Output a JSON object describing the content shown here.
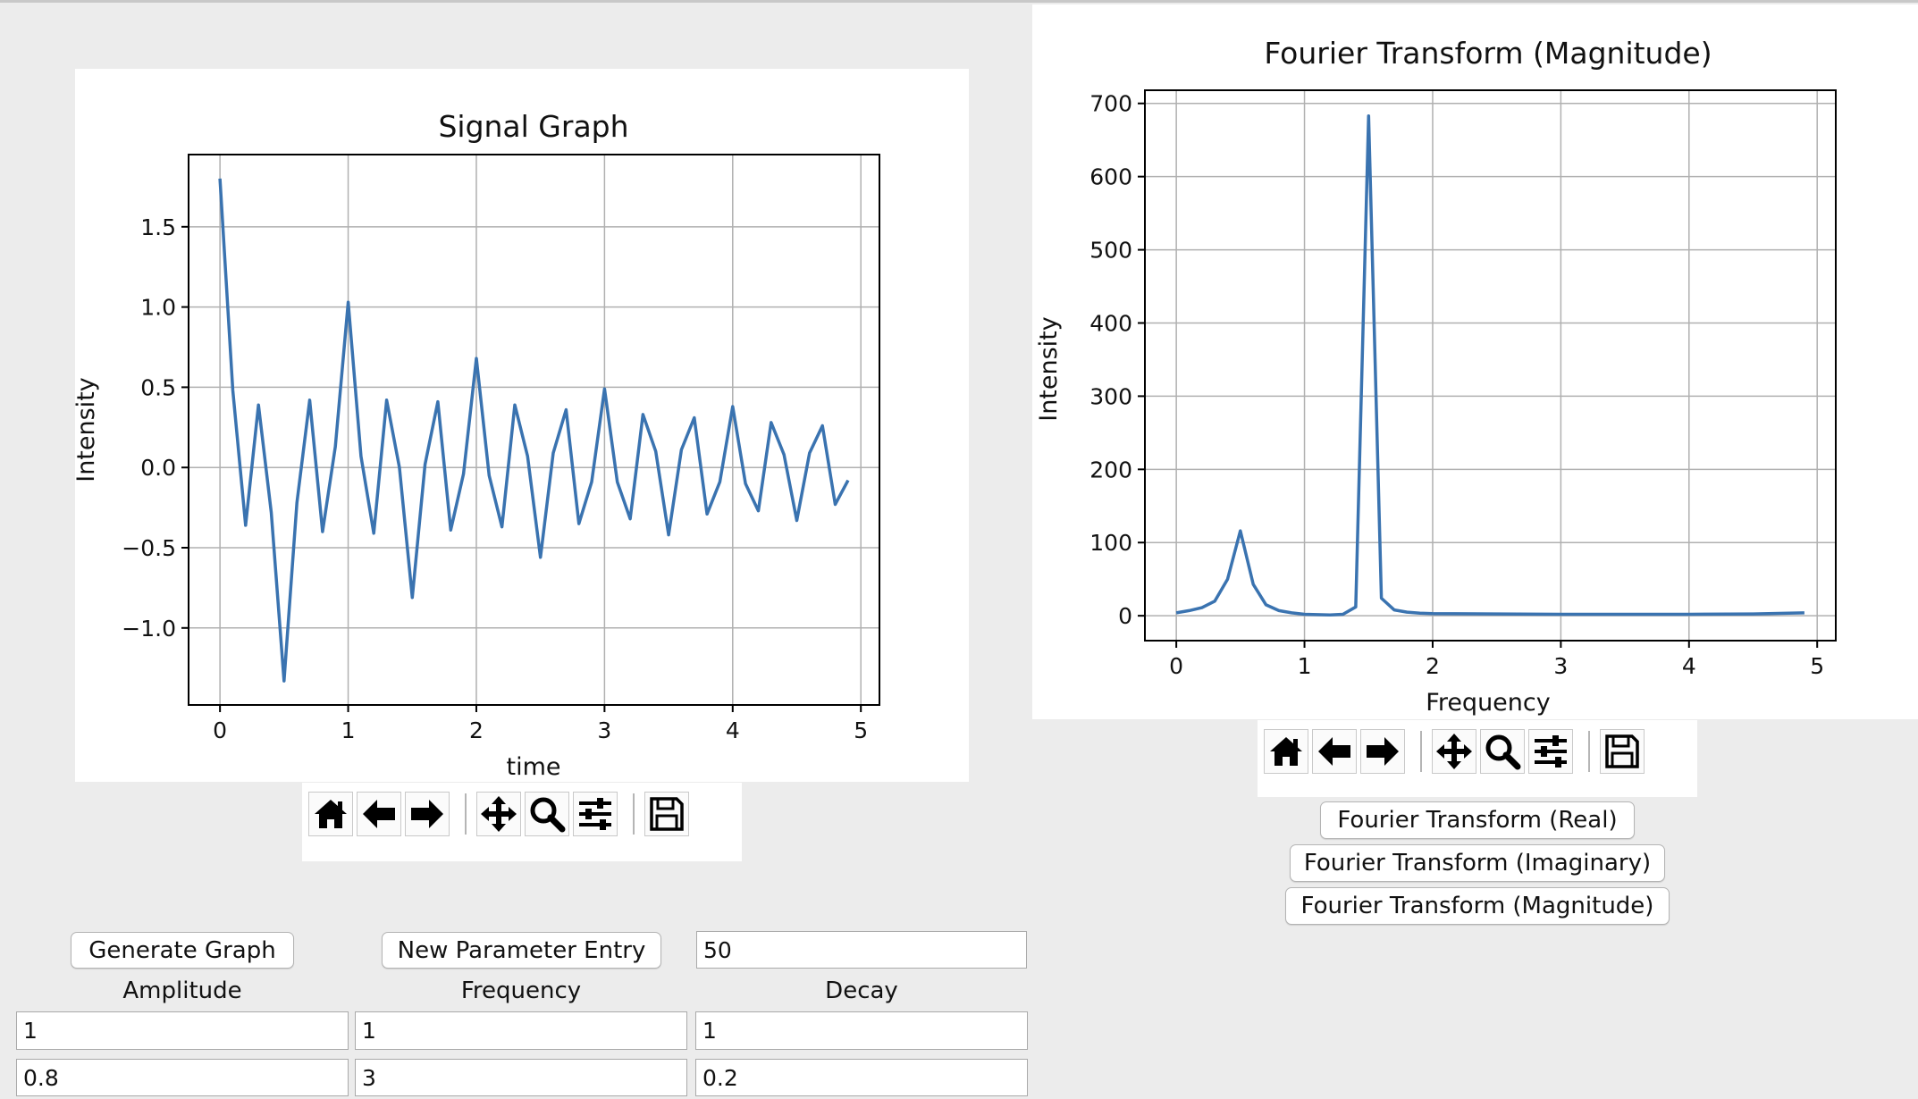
{
  "signal_plot": {
    "chart_data": {
      "type": "line",
      "title": "Signal Graph",
      "xlabel": "time",
      "ylabel": "Intensity",
      "xlim": [
        -0.245,
        5.145
      ],
      "ylim": [
        -1.48,
        1.95
      ],
      "xticks": [
        0,
        1,
        2,
        3,
        4,
        5
      ],
      "yticks": [
        -1.0,
        -0.5,
        0.0,
        0.5,
        1.0,
        1.5
      ],
      "ytick_labels": [
        "−1.0",
        "−0.5",
        "0.0",
        "0.5",
        "1.0",
        "1.5"
      ],
      "grid": true,
      "series": [
        {
          "color": "#3a73b0",
          "x": [
            0,
            0.1,
            0.2,
            0.3,
            0.4,
            0.5,
            0.6,
            0.7,
            0.8,
            0.9,
            1.0,
            1.1,
            1.2,
            1.3,
            1.4,
            1.5,
            1.6,
            1.7,
            1.8,
            1.9,
            2.0,
            2.1,
            2.2,
            2.3,
            2.4,
            2.5,
            2.6,
            2.7,
            2.8,
            2.9,
            3.0,
            3.1,
            3.2,
            3.3,
            3.4,
            3.5,
            3.6,
            3.7,
            3.8,
            3.9,
            4.0,
            4.1,
            4.2,
            4.3,
            4.4,
            4.5,
            4.6,
            4.7,
            4.8,
            4.9
          ],
          "y": [
            1.8,
            0.48,
            -0.36,
            0.39,
            -0.28,
            -1.33,
            -0.22,
            0.42,
            -0.4,
            0.13,
            1.03,
            0.07,
            -0.41,
            0.42,
            0.0,
            -0.81,
            0.02,
            0.41,
            -0.39,
            -0.04,
            0.68,
            -0.05,
            -0.37,
            0.39,
            0.07,
            -0.56,
            0.09,
            0.36,
            -0.35,
            -0.09,
            0.49,
            -0.09,
            -0.32,
            0.33,
            0.1,
            -0.42,
            0.11,
            0.31,
            -0.29,
            -0.09,
            0.38,
            -0.1,
            -0.27,
            0.28,
            0.08,
            -0.33,
            0.09,
            0.26,
            -0.23,
            -0.08
          ]
        }
      ]
    },
    "toolbar": {
      "home_icon": "home-icon",
      "back_icon": "arrow-left-icon",
      "forward_icon": "arrow-right-icon",
      "pan_icon": "move-icon",
      "zoom_icon": "zoom-icon",
      "configure_icon": "sliders-icon",
      "save_icon": "save-icon"
    }
  },
  "fourier_plot": {
    "chart_data": {
      "type": "line",
      "title": "Fourier Transform (Magnitude)",
      "xlabel": "Frequency",
      "ylabel": "Intensity",
      "xlim": [
        -0.245,
        5.145
      ],
      "ylim": [
        -34,
        718
      ],
      "xticks": [
        0,
        1,
        2,
        3,
        4,
        5
      ],
      "yticks": [
        0,
        100,
        200,
        300,
        400,
        500,
        600,
        700
      ],
      "grid": true,
      "series": [
        {
          "color": "#3a73b0",
          "x": [
            0,
            0.1,
            0.2,
            0.3,
            0.4,
            0.5,
            0.6,
            0.7,
            0.8,
            0.9,
            1.0,
            1.1,
            1.2,
            1.3,
            1.4,
            1.5,
            1.6,
            1.7,
            1.8,
            1.9,
            2.0,
            2.5,
            3.0,
            3.5,
            4.0,
            4.5,
            4.9
          ],
          "y": [
            4,
            7,
            11,
            20,
            50,
            116,
            43,
            15,
            7,
            4,
            2,
            1.5,
            1,
            2,
            12,
            683,
            24,
            8,
            5,
            3.5,
            3,
            2.5,
            2,
            2,
            2,
            2.5,
            4
          ]
        }
      ]
    },
    "toolbar": {
      "home_icon": "home-icon",
      "back_icon": "arrow-left-icon",
      "forward_icon": "arrow-right-icon",
      "pan_icon": "move-icon",
      "zoom_icon": "zoom-icon",
      "configure_icon": "sliders-icon",
      "save_icon": "save-icon"
    }
  },
  "transform_buttons": {
    "real": "Fourier Transform (Real)",
    "imaginary": "Fourier Transform (Imaginary)",
    "magnitude": "Fourier Transform (Magnitude)"
  },
  "controls": {
    "generate_button": "Generate Graph",
    "new_parameter_button": "New Parameter Entry",
    "points_value": "50",
    "headers": {
      "amplitude": "Amplitude",
      "frequency": "Frequency",
      "decay": "Decay"
    },
    "rows": [
      {
        "amplitude": "1",
        "frequency": "1",
        "decay": "1"
      },
      {
        "amplitude": "0.8",
        "frequency": "3",
        "decay": "0.2"
      }
    ]
  }
}
